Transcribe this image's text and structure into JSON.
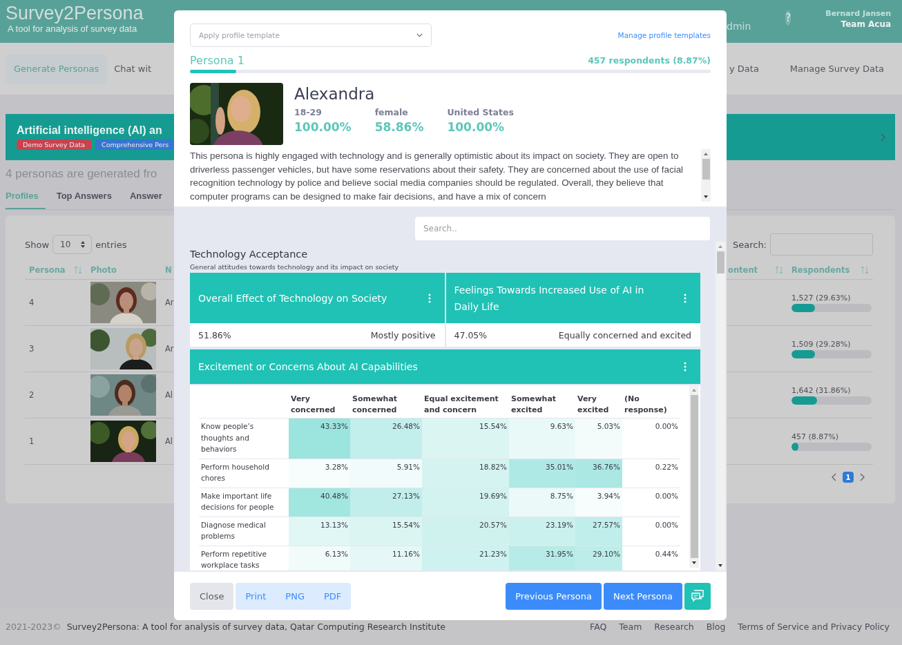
{
  "header": {
    "logo": "Survey2Persona",
    "tagline": "A tool for analysis of survey data",
    "menu_item": "dmin",
    "help_icon": "?",
    "user_name": "Bernard Jansen",
    "team": "Team Acua"
  },
  "nav": {
    "left": [
      {
        "label": "Generate Personas",
        "selected": true
      },
      {
        "label": "Chat wit",
        "selected": false
      }
    ],
    "right": [
      {
        "label": "y Data",
        "selected": false
      },
      {
        "label": "Manage Survey Data",
        "selected": false
      }
    ]
  },
  "survey": {
    "title": "Artificial intelligence (AI) an",
    "tags": [
      {
        "label": "Demo Survey Data",
        "color": "#c8434f"
      },
      {
        "label": "Comprehensive Pers",
        "color": "#3576cf"
      }
    ]
  },
  "summary": "4 personas are generated fro",
  "tabs": [
    {
      "label": "Profiles",
      "selected": true
    },
    {
      "label": "Top Answers",
      "selected": false
    },
    {
      "label": "Answer",
      "selected": false
    }
  ],
  "table": {
    "show_label": "Show",
    "length": "10",
    "entries_label": "entries",
    "search_label": "Search:",
    "columns": [
      "Persona",
      "Photo",
      "N",
      "ontent",
      "Respondents"
    ],
    "rows": [
      {
        "persona": "4",
        "name": "Ar",
        "respondents": "1,527 (29.63%)",
        "level": 0.2963
      },
      {
        "persona": "3",
        "name": "Ar",
        "respondents": "1,509 (29.28%)",
        "level": 0.2928
      },
      {
        "persona": "2",
        "name": "Al",
        "respondents": "1,642 (31.86%)",
        "level": 0.3186
      },
      {
        "persona": "1",
        "name": "Al",
        "respondents": "457 (8.87%)",
        "level": 0.0887
      }
    ],
    "pages": [
      {
        "label": "1",
        "selected": true
      }
    ]
  },
  "footer": {
    "copyright": "2021-2023©",
    "text": "Survey2Persona: A tool for analysis of survey data, Qatar Computing Research Institute",
    "links": [
      "FAQ",
      "Team",
      "Research",
      "Blog",
      "Terms of Service and Privacy Policy"
    ]
  },
  "modal": {
    "template_select": {
      "placeholder": "Apply profile template"
    },
    "manage_link": "Manage profile templates",
    "persona_label": "Persona 1",
    "respondents": "457 respondents (8.87%)",
    "level": 0.0887,
    "name": "Alexandra",
    "stats": [
      {
        "label": "18-29",
        "value": "100.00%"
      },
      {
        "label": "female",
        "value": "58.86%"
      },
      {
        "label": "United States",
        "value": "100.00%"
      }
    ],
    "description": "This persona is highly engaged with technology and is generally optimistic about its impact on society. They are open to driverless passenger vehicles, but have some reservations about their safety. They are concerned about the use of facial recognition technology by police and believe social media companies should be regulated. Overall, they believe that computer programs can be designed to make fair decisions, and have a mix of concern",
    "search": {
      "placeholder": "Search.."
    },
    "section": {
      "title": "Technology Acceptance",
      "subtitle": "General attitudes towards technology and its impact on society"
    },
    "cards": [
      {
        "title": "Overall Effect of Technology on Society",
        "value": "51.86%",
        "answer": "Mostly positive"
      },
      {
        "title": "Feelings Towards Increased Use of AI in Daily Life",
        "value": "47.05%",
        "answer": "Equally concerned and excited"
      }
    ],
    "matrix": {
      "title": "Excitement or Concerns About AI Capabilities",
      "columns": [
        "Very concerned",
        "Somewhat concerned",
        "Equal excitement and concern",
        "Somewhat excited",
        "Very excited",
        "(No response)"
      ],
      "rows": [
        {
          "label": "Know people’s thoughts and behaviors",
          "values": [
            "43.33%",
            "26.48%",
            "15.54%",
            "9.63%",
            "5.03%",
            "0.00%"
          ]
        },
        {
          "label": "Perform household chores",
          "values": [
            "3.28%",
            "5.91%",
            "18.82%",
            "35.01%",
            "36.76%",
            "0.22%"
          ]
        },
        {
          "label": "Make important life decisions for people",
          "values": [
            "40.48%",
            "27.13%",
            "19.69%",
            "8.75%",
            "3.94%",
            "0.00%"
          ]
        },
        {
          "label": "Diagnose medical problems",
          "values": [
            "13.13%",
            "15.54%",
            "20.57%",
            "23.19%",
            "27.57%",
            "0.00%"
          ]
        },
        {
          "label": "Perform repetitive workplace tasks",
          "values": [
            "6.13%",
            "11.16%",
            "21.23%",
            "31.95%",
            "29.10%",
            "0.44%"
          ]
        }
      ]
    },
    "buttons": {
      "close": "Close",
      "exports": [
        "Print",
        "PNG",
        "PDF"
      ],
      "previous": "Previous Persona",
      "next": "Next Persona"
    }
  }
}
